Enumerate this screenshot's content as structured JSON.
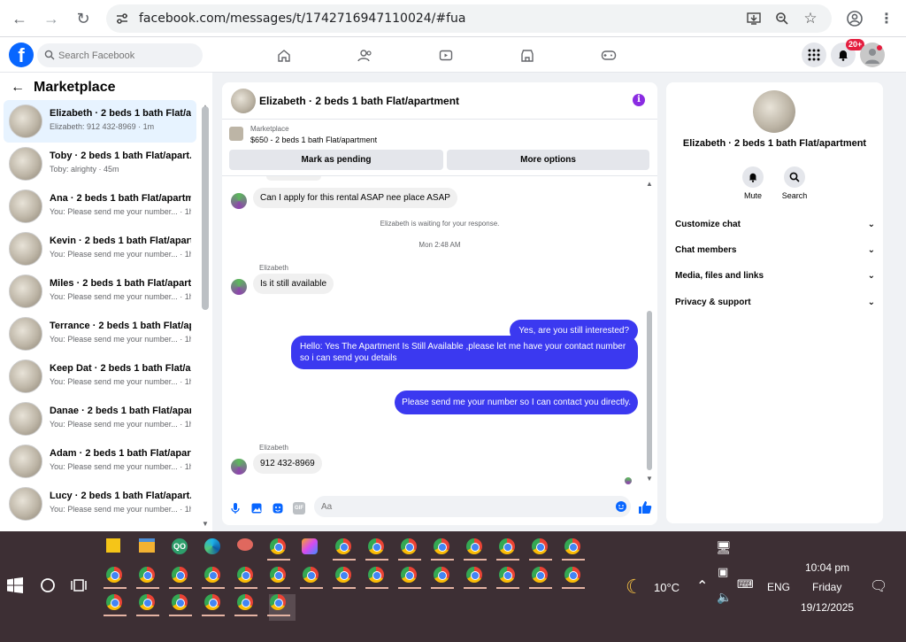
{
  "browser": {
    "url": "facebook.com/messages/t/1742716947110024/#fua"
  },
  "fb": {
    "search_placeholder": "Search Facebook",
    "notif_badge": "20+"
  },
  "left": {
    "title": "Marketplace",
    "conversations": [
      {
        "name": "Elizabeth · 2 beds 1 bath Flat/a...",
        "preview": "Elizabeth: 912 432-8969 · 1m"
      },
      {
        "name": "Toby · 2 beds 1 bath Flat/apart...",
        "preview": "Toby: alrighty · 45m"
      },
      {
        "name": "Ana · 2 beds 1 bath Flat/apartm...",
        "preview": "You: Please send me your number... · 1h"
      },
      {
        "name": "Kevin · 2 beds 1 bath Flat/apart...",
        "preview": "You: Please send me your number... · 1h"
      },
      {
        "name": "Miles · 2 beds 1 bath Flat/apart...",
        "preview": "You: Please send me your number... · 1h"
      },
      {
        "name": "Terrance · 2 beds 1 bath Flat/ap...",
        "preview": "You: Please send me your number... · 1h"
      },
      {
        "name": "Keep Dat · 2 beds 1 bath Flat/a...",
        "preview": "You: Please send me your number... · 1h"
      },
      {
        "name": "Danae · 2 beds 1 bath Flat/apar...",
        "preview": "You: Please send me your number... · 1h"
      },
      {
        "name": "Adam · 2 beds 1 bath Flat/apart...",
        "preview": "You: Please send me your number... · 1h"
      },
      {
        "name": "Lucy · 2 beds 1 bath Flat/apart...",
        "preview": "You: Please send me your number... · 1h"
      }
    ]
  },
  "chat": {
    "title": "Elizabeth · 2 beds 1 bath Flat/apartment",
    "marketplace_label": "Marketplace",
    "listing": "$650 - 2 beds 1 bath Flat/apartment",
    "btn_pending": "Mark as pending",
    "btn_more": "More options",
    "msg1": "Can I apply for this rental ASAP nee place ASAP",
    "waiting": "Elizabeth is waiting for your response.",
    "timestamp": "Mon 2:48 AM",
    "sender": "Elizabeth",
    "msg2": "Is it still available",
    "out1": "Yes, are you still interested?",
    "out2": "Hello: Yes The Apartment Is Still Available ,please let me have your contact number so i can send you details",
    "out3": "Please send me your number so I can contact you directly.",
    "sender2": "Elizabeth",
    "msg3": "912 432-8969",
    "composer_placeholder": "Aa"
  },
  "right": {
    "name": "Elizabeth · 2 beds 1 bath Flat/apartment",
    "mute": "Mute",
    "search": "Search",
    "sections": [
      "Customize chat",
      "Chat members",
      "Media, files and links",
      "Privacy & support"
    ]
  },
  "taskbar": {
    "temp": "10°C",
    "lang": "ENG",
    "time": "10:04 pm",
    "day": "Friday",
    "date": "19/12/2025"
  }
}
